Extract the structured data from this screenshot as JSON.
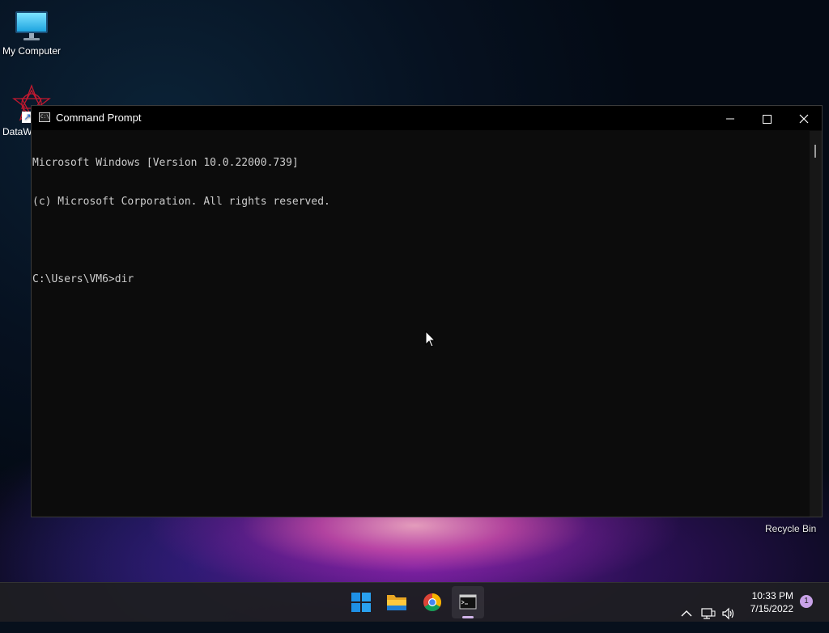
{
  "desktop": {
    "icons": [
      {
        "label": "My Computer"
      },
      {
        "label": "DataW"
      }
    ],
    "recycle_bin": "Recycle Bin"
  },
  "window": {
    "title": "Command Prompt",
    "icon_text": "C:\\",
    "console_lines": [
      "Microsoft Windows [Version 10.0.22000.739]",
      "(c) Microsoft Corporation. All rights reserved.",
      "",
      "C:\\Users\\VM6>dir"
    ]
  },
  "taskbar": {
    "apps": [
      "start-button",
      "file-explorer",
      "chrome",
      "command-prompt"
    ],
    "clock": {
      "time": "10:33 PM",
      "date": "7/15/2022"
    },
    "notification_count": "1"
  },
  "colors": {
    "console_bg": "#0c0c0c",
    "console_fg": "#cccccc",
    "start_blue": "#1e90e6"
  }
}
